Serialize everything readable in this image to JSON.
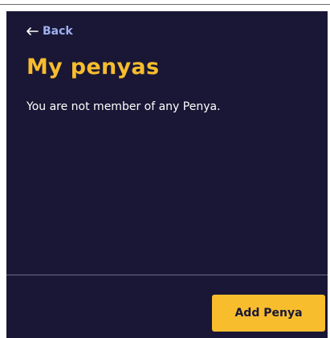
{
  "header": {
    "back_label": "Back",
    "back_icon": "arrow-left-icon",
    "title": "My penyas"
  },
  "main": {
    "empty_message": "You are not member of any Penya."
  },
  "footer": {
    "add_button_label": "Add Penya"
  },
  "colors": {
    "background": "#191735",
    "accent": "#f7bd2d",
    "link": "#9fb0f0",
    "text": "#ffffff"
  }
}
